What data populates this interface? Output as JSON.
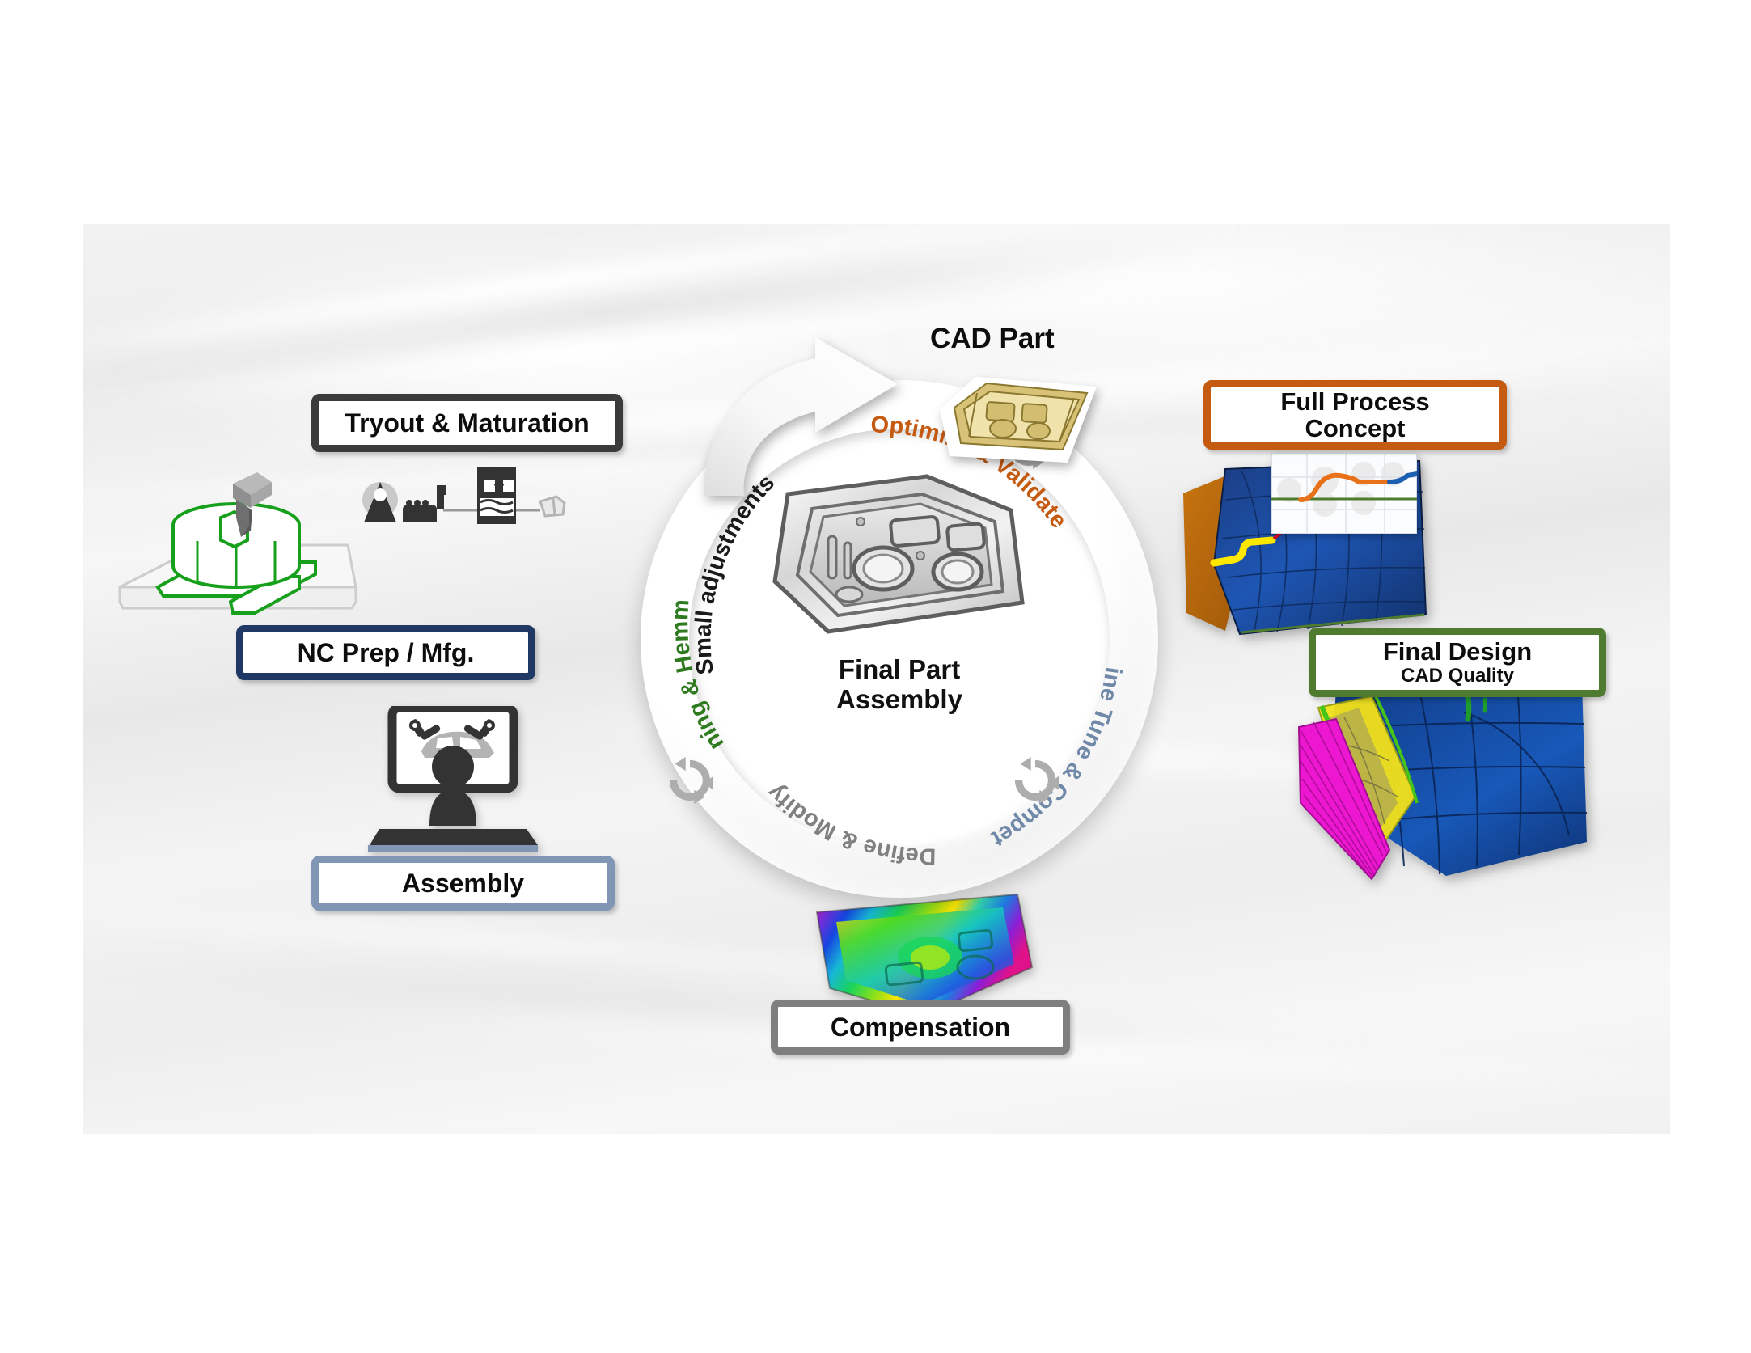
{
  "diagram": {
    "title_visible": false
  },
  "cycle": {
    "center_title": "Final Part\nAssembly",
    "segments": [
      {
        "id": "small-adjustments",
        "label": "Small adjustments",
        "color": "#1a1a1a"
      },
      {
        "id": "optimize-validate",
        "label": "Optimize & Validate",
        "color": "#C55A11"
      },
      {
        "id": "fine-tune-compete",
        "label": "Fine Tune & Compete",
        "color": "#7089A8"
      },
      {
        "id": "define-modify",
        "label": "Define & Modify",
        "color": "#808080"
      },
      {
        "id": "joining-hemming",
        "label": "Joining & Hemming",
        "color": "#2E7A1F"
      }
    ]
  },
  "cad_part": {
    "label": "CAD Part",
    "color": "#0d0d0d"
  },
  "boxes": {
    "tryout": {
      "label": "Tryout & Maturation",
      "border_color": "#3b3b3b"
    },
    "ncprep": {
      "label": "NC Prep / Mfg.",
      "border_color": "#1f3864"
    },
    "assembly": {
      "label": "Assembly",
      "border_color": "#8096b4"
    },
    "compensation": {
      "label": "Compensation",
      "border_color": "#7f7f7f"
    },
    "full_process": {
      "label": "Full Process\nConcept",
      "border_color": "#C55A11"
    },
    "final_design": {
      "label": "Final Design",
      "sub_label": "CAD Quality",
      "border_color": "#4E7B2E"
    }
  },
  "icons": {
    "nc_machine": "nc-milling-machine-icon",
    "stamping_press": "stamping-press-line-icon",
    "assembly_station": "assembly-operator-monitor-icon",
    "recycle": "refresh-cycle-icon",
    "entry_arrow": "curved-arrow-icon"
  },
  "colors": {
    "orange": "#C55A11",
    "green": "#4E7B2E",
    "navy": "#1f3864",
    "steel_blue": "#8096b4",
    "gray": "#7f7f7f",
    "dark_gray": "#3b3b3b",
    "cycle_green": "#2E7A1F",
    "cycle_blue": "#7089A8",
    "panel_bg": "#f1f1f1"
  }
}
